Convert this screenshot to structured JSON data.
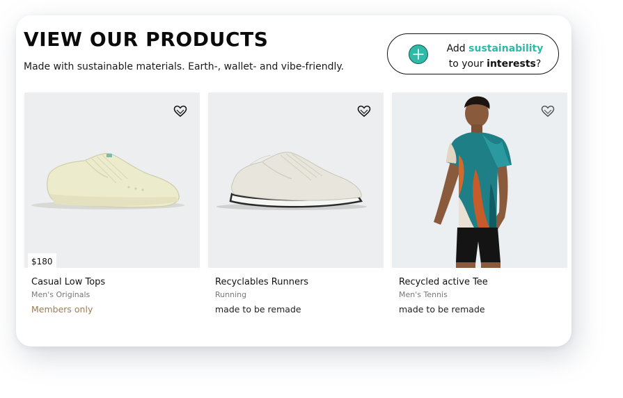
{
  "header": {
    "title": "VIEW OUR PRODUCTS",
    "subtitle": "Made with sustainable materials. Earth-, wallet- and vibe-friendly."
  },
  "cta": {
    "prefix": "Add ",
    "highlight": "sustainability",
    "line2_prefix": "to your ",
    "line2_bold": "interests",
    "line2_suffix": "?",
    "accent_color": "#2fb9a6",
    "icon": "plus-circle-icon"
  },
  "products": [
    {
      "name": "Casual Low Tops",
      "category": "Men's Originals",
      "tag": "Members only",
      "price": "$180",
      "image": "cream-low-top-sneaker",
      "icon": "heart-icon"
    },
    {
      "name": "Recyclables Runners",
      "category": "Running",
      "tag": "made to be remade",
      "image": "white-running-shoe",
      "icon": "heart-icon"
    },
    {
      "name": "Recycled active Tee",
      "category": "Men's Tennis",
      "tag": "made to be remade",
      "image": "man-in-tie-dye-tee",
      "icon": "heart-icon"
    }
  ]
}
